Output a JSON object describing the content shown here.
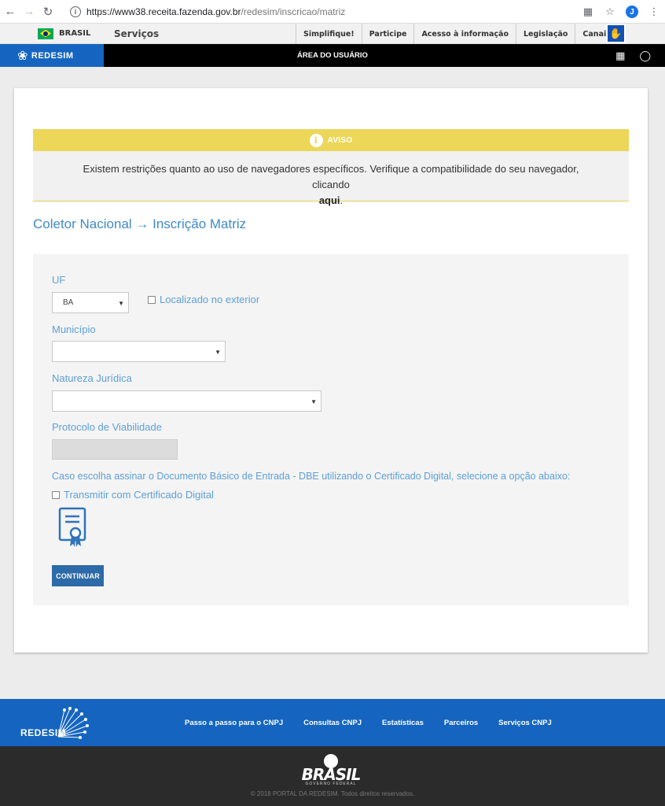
{
  "browser": {
    "url_host": "https://www38.receita.fazenda.gov.br",
    "url_path": "/redesim/inscricao/matriz",
    "avatar_letter": "J"
  },
  "gov_bar": {
    "brasil": "BRASIL",
    "servicos": "Serviços",
    "links": [
      "Simplifique!",
      "Participe",
      "Acesso à informação",
      "Legislação",
      "Canais"
    ]
  },
  "redesim_bar": {
    "logo": "REDESIM",
    "area": "ÁREA DO USUÁRIO"
  },
  "aviso": {
    "title": "AVISO",
    "message": "Existem restrições quanto ao uso de navegadores específicos. Verifique a compatibilidade do seu navegador, clicando",
    "link": "aqui",
    "end": "."
  },
  "breadcrumb": "Coletor Nacional → Inscrição Matriz",
  "form": {
    "uf_label": "UF",
    "uf_value": "BA",
    "exterior_label": "Localizado no exterior",
    "municipio_label": "Município",
    "municipio_value": "",
    "natureza_label": "Natureza Jurídica",
    "natureza_value": "",
    "protocolo_label": "Protocolo de Viabilidade",
    "cert_note": "Caso escolha assinar o Documento Básico de Entrada - DBE utilizando o Certificado Digital, selecione a opção abaixo:",
    "cert_checkbox": "Transmitir com Certificado Digital",
    "continue_button": "CONTINUAR"
  },
  "footer": {
    "logo": "REDESIM",
    "links": [
      "Passo a passo para o CNPJ",
      "Consultas CNPJ",
      "Estatísticas",
      "Parceiros",
      "Serviços CNPJ"
    ],
    "brasil_logo": "BRASIL",
    "brasil_sub": "GOVERNO FEDERAL",
    "copyright": "© 2018 PORTAL DA REDESIM. Todos direitos reservados."
  },
  "colors": {
    "accent_blue": "#1565c0",
    "label_blue": "#5d9fd6",
    "aviso_yellow": "#ecd759",
    "button_blue": "#2d6aa8"
  }
}
